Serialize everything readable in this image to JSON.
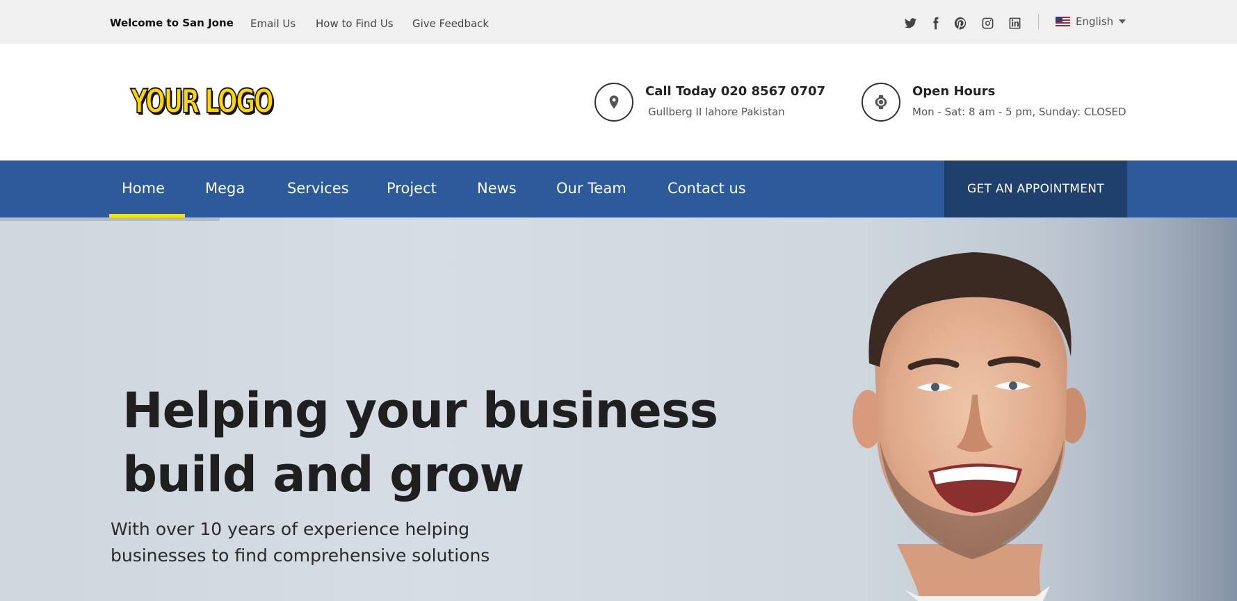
{
  "topbar": {
    "welcome": "Welcome to San Jone",
    "links": [
      "Email Us",
      "How to Find Us",
      "Give Feedback"
    ],
    "social_icons": [
      "twitter-icon",
      "facebook-icon",
      "pinterest-icon",
      "instagram-icon",
      "linkedin-icon"
    ],
    "language": "English"
  },
  "header": {
    "logo_text": "YOUR LOGO",
    "call": {
      "title": "Call Today 020 8567 0707",
      "sub": "Gullberg II lahore Pakistan",
      "icon": "location-pin-icon"
    },
    "hours": {
      "title": "Open Hours",
      "sub": "Mon - Sat: 8 am - 5 pm, Sunday: CLOSED",
      "icon": "watch-icon"
    }
  },
  "nav": {
    "items": [
      "Home",
      "Mega",
      "Services",
      "Project",
      "News",
      "Our Team",
      "Contact us"
    ],
    "active": "Home",
    "cta": "GET AN APPOINTMENT"
  },
  "hero": {
    "title_line1": "Helping your business",
    "title_line2": "build and grow",
    "sub_line1": "With over 10 years of experience helping",
    "sub_line2": "businesses to find comprehensive solutions"
  },
  "colors": {
    "nav_bg": "#2d5a9a",
    "cta_bg": "#1f3f6d",
    "active_underline": "#f2e500",
    "logo_yellow": "#ffd500"
  }
}
